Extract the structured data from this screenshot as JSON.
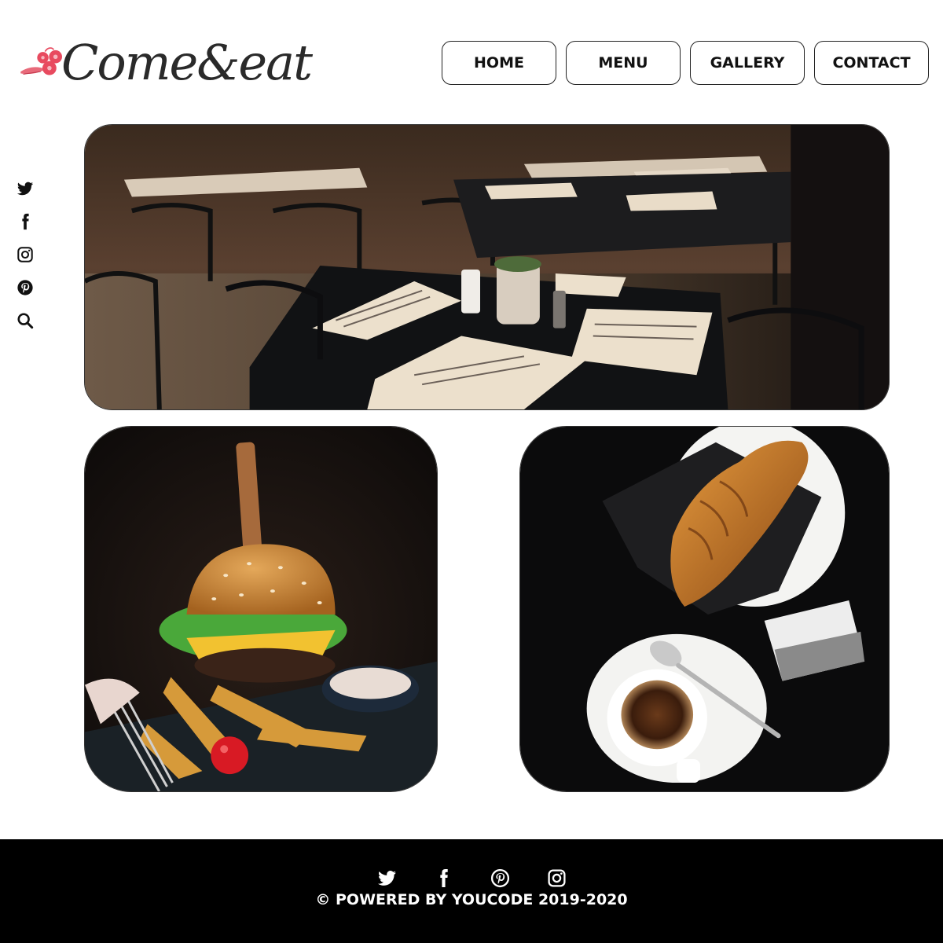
{
  "brand": {
    "name": "Come&eat",
    "logo_icon": "berries-logo-icon",
    "accent": "#e84a5f"
  },
  "nav": {
    "home": "HOME",
    "menu": "MENU",
    "gallery": "GALLERY",
    "contact": "CONTACT"
  },
  "side_social": [
    "twitter-icon",
    "facebook-icon",
    "instagram-icon",
    "pinterest-icon",
    "search-icon"
  ],
  "gallery": [
    {
      "name": "restaurant-interior-photo"
    },
    {
      "name": "burger-photo"
    },
    {
      "name": "croissant-coffee-photo"
    }
  ],
  "footer": {
    "icons": [
      "twitter-icon",
      "facebook-icon",
      "pinterest-icon",
      "instagram-icon"
    ],
    "copyright": "© POWERED BY YOUCODE 2019-2020"
  }
}
